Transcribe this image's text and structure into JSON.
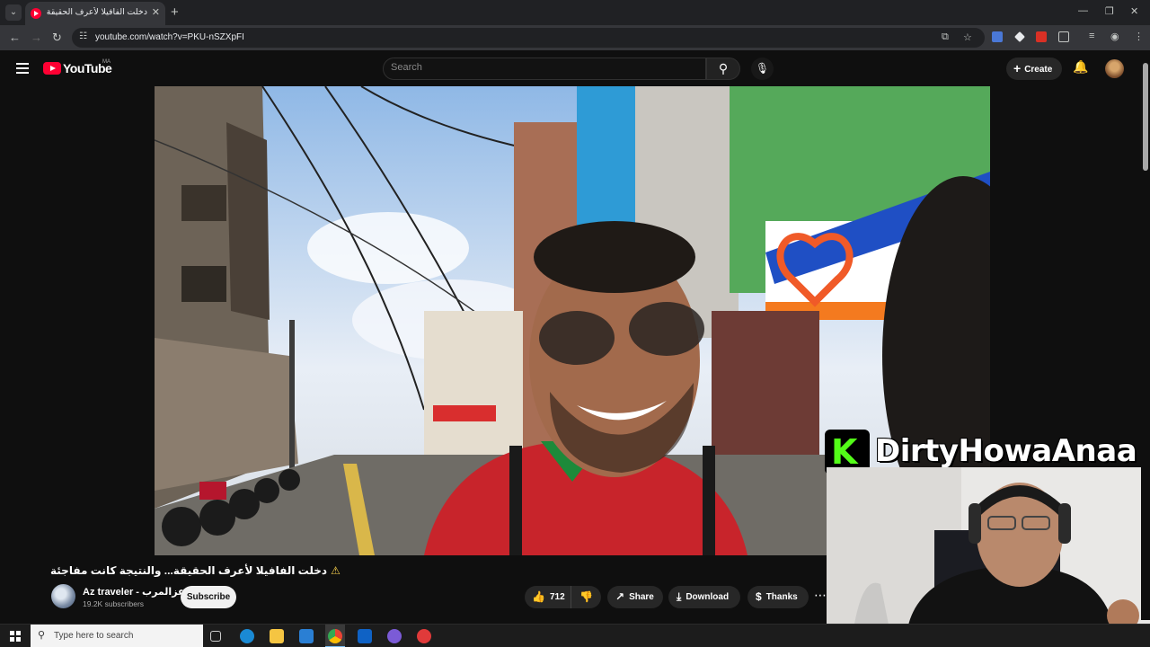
{
  "browser": {
    "tab_title": "دخلت الفافيلا لأعرف الحقيقة...",
    "url": "youtube.com/watch?v=PKU-nSZXpFI"
  },
  "youtube": {
    "logo_text": "YouTube",
    "country_code": "MA",
    "search_placeholder": "Search",
    "create_label": "Create"
  },
  "video": {
    "title": "دخلت الفافيلا لأعرف الحقيقة... والنتيجة كانت مفاجئة",
    "channel_name": "Az traveler - عزالمرب",
    "subscribers": "19.2K subscribers",
    "subscribe_label": "Subscribe",
    "likes": "712",
    "share_label": "Share",
    "download_label": "Download",
    "thanks_label": "Thanks"
  },
  "overlay": {
    "kick_letter": "K",
    "streamer_name": "DirtyHowaAnaa"
  },
  "taskbar": {
    "search_placeholder": "Type here to search"
  }
}
